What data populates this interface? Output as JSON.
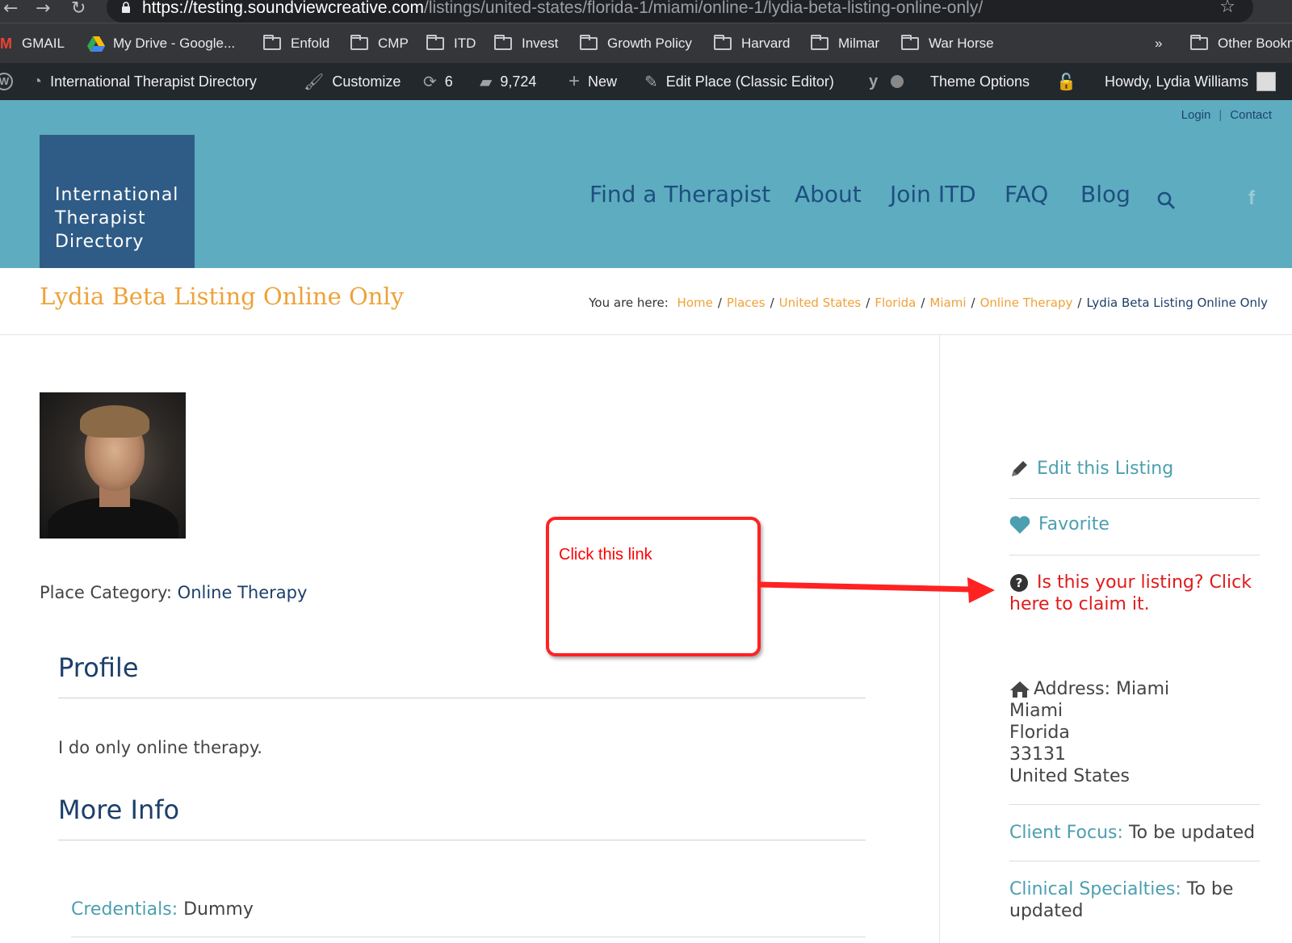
{
  "browser": {
    "url_host": "https://testing.soundviewcreative.com",
    "url_path": "/listings/united-states/florida-1/miami/online-1/lydia-beta-listing-online-only/"
  },
  "bookmarks": {
    "items": [
      "GMAIL",
      "My Drive - Google...",
      "Enfold",
      "CMP",
      "ITD",
      "Invest",
      "Growth Policy",
      "Harvard",
      "Milmar",
      "War Horse"
    ],
    "overflow": "»",
    "other": "Other Bookmarks"
  },
  "adminbar": {
    "site": "International Therapist Directory",
    "customize": "Customize",
    "updates": "6",
    "comments": "9,724",
    "new": "New",
    "edit": "Edit Place (Classic Editor)",
    "theme_options": "Theme Options",
    "howdy": "Howdy, Lydia Williams"
  },
  "header": {
    "logo_lines": [
      "International",
      "Therapist",
      "Directory"
    ],
    "top_links": [
      "Login",
      "Contact"
    ],
    "nav": [
      "Find a Therapist",
      "About",
      "Join ITD",
      "FAQ",
      "Blog"
    ],
    "facebook": "f"
  },
  "titlebar": {
    "title": "Lydia Beta Listing Online Only",
    "breadcrumb_prefix": "You are here:",
    "crumbs": [
      "Home",
      "Places",
      "United States",
      "Florida",
      "Miami",
      "Online Therapy"
    ],
    "current": "Lydia Beta Listing Online Only"
  },
  "content": {
    "place_category_label": "Place Category:",
    "place_category_value": "Online Therapy",
    "profile_heading": "Profile",
    "profile_text": "I do only online therapy.",
    "more_info_heading": "More Info",
    "credentials_label": "Credentials:",
    "credentials_value": "Dummy"
  },
  "annotation": {
    "text": "Click this link",
    "color": "#ff2222"
  },
  "sidebar": {
    "edit": "Edit this Listing",
    "favorite": "Favorite",
    "claim_line1": "Is this your listing? Click",
    "claim_line2": "here to claim it.",
    "address_label": "Address: Miami",
    "address_lines": [
      "Miami",
      "Florida",
      "33131",
      "United States"
    ],
    "client_focus_label": "Client Focus:",
    "client_focus_value": "To be updated",
    "clinical_label": "Clinical Specialties:",
    "clinical_value_1": "To be",
    "clinical_value_2": "updated"
  },
  "colors": {
    "header_bg": "#5eacbf",
    "logo_bg": "#2f5c86",
    "title": "#eea23a",
    "nav": "#1d4f80",
    "accent_teal": "#4c9fb0",
    "claim_red": "#e01b1b"
  }
}
